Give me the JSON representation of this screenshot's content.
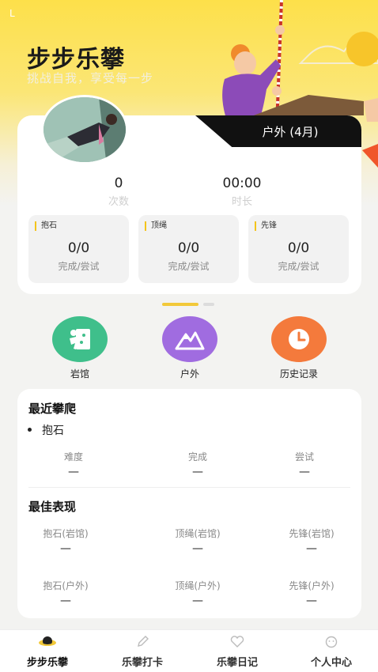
{
  "app": {
    "title": "步步乐攀",
    "subtitle": "挑战自我，享受每一步"
  },
  "status": {
    "mark": "L"
  },
  "summary": {
    "tab_label": "户外 (4月)",
    "count_value": "0",
    "count_label": "次数",
    "duration_value": "00:00",
    "duration_label": "时长",
    "types": [
      {
        "name": "抱石",
        "value": "0/0",
        "caption": "完成/尝试"
      },
      {
        "name": "顶绳",
        "value": "0/0",
        "caption": "完成/尝试"
      },
      {
        "name": "先锋",
        "value": "0/0",
        "caption": "完成/尝试"
      }
    ]
  },
  "quick_actions": [
    {
      "label": "岩馆",
      "color": "#3fbf8b",
      "icon": "gym-icon"
    },
    {
      "label": "户外",
      "color": "#a06ce0",
      "icon": "mountain-icon"
    },
    {
      "label": "历史记录",
      "color": "#f47a3c",
      "icon": "clock-icon"
    }
  ],
  "recent": {
    "title": "最近攀爬",
    "item": "抱石",
    "columns": [
      {
        "header": "难度",
        "value": "—"
      },
      {
        "header": "完成",
        "value": "—"
      },
      {
        "header": "尝试",
        "value": "—"
      }
    ]
  },
  "best": {
    "title": "最佳表现",
    "rows": [
      [
        {
          "header": "抱石(岩馆)",
          "value": "—"
        },
        {
          "header": "顶绳(岩馆)",
          "value": "—"
        },
        {
          "header": "先锋(岩馆)",
          "value": "—"
        }
      ],
      [
        {
          "header": "抱石(户外)",
          "value": "—"
        },
        {
          "header": "顶绳(户外)",
          "value": "—"
        },
        {
          "header": "先锋(户外)",
          "value": "—"
        }
      ]
    ]
  },
  "tabbar": [
    {
      "label": "步步乐攀",
      "icon": "planet-icon",
      "active": true
    },
    {
      "label": "乐攀打卡",
      "icon": "pencil-icon",
      "active": false
    },
    {
      "label": "乐攀日记",
      "icon": "heart-icon",
      "active": false
    },
    {
      "label": "个人中心",
      "icon": "smile-icon",
      "active": false
    }
  ],
  "colors": {
    "brand_yellow": "#fde04a",
    "accent": "#f2c93a"
  }
}
